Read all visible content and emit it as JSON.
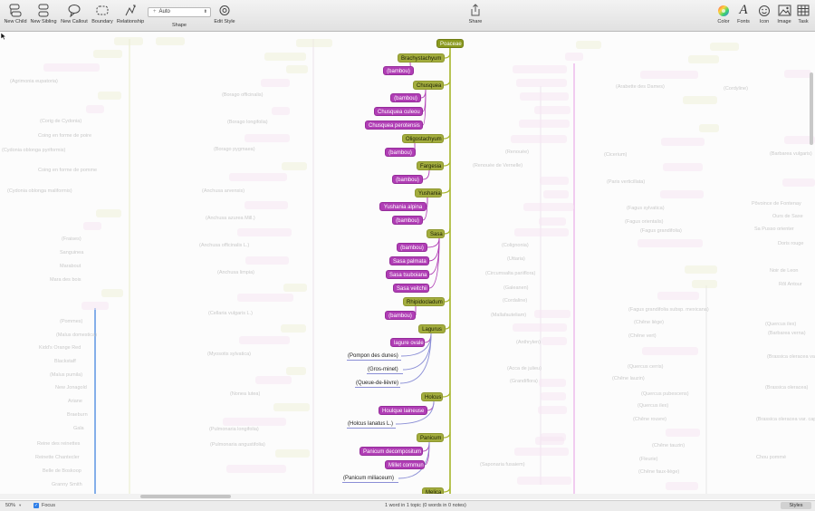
{
  "toolbar": {
    "new_child": "New Child",
    "new_sibling": "New Sibling",
    "new_callout": "New Callout",
    "boundary": "Boundary",
    "relationship": "Relationship",
    "shape_value": "Auto",
    "shape": "Shape",
    "edit_style": "Edit Style",
    "share": "Share",
    "color": "Color",
    "fonts": "Fonts",
    "icon": "Icon",
    "image": "Image",
    "task": "Task"
  },
  "map": {
    "root": "Poaceae",
    "nodes": [
      {
        "text": "Brachystachyum",
        "kind": "genus"
      },
      {
        "text": "(bambou)",
        "kind": "species"
      },
      {
        "text": "Chusquea",
        "kind": "genus"
      },
      {
        "text": "(bambou)",
        "kind": "species"
      },
      {
        "text": "Chusquea culeou",
        "kind": "species"
      },
      {
        "text": "Chusquea perotensis",
        "kind": "species"
      },
      {
        "text": "Oligostachyum",
        "kind": "genus"
      },
      {
        "text": "(bambou)",
        "kind": "species"
      },
      {
        "text": "Fargesia",
        "kind": "genus"
      },
      {
        "text": "(bambou)",
        "kind": "species"
      },
      {
        "text": "Yushania",
        "kind": "genus"
      },
      {
        "text": "Yushania alpina",
        "kind": "species"
      },
      {
        "text": "(bambou)",
        "kind": "species"
      },
      {
        "text": "Sasa",
        "kind": "genus"
      },
      {
        "text": "(bambou)",
        "kind": "species"
      },
      {
        "text": "Sasa palmata",
        "kind": "species"
      },
      {
        "text": "Sasa tsuboiana",
        "kind": "species"
      },
      {
        "text": "Sasa veitchii",
        "kind": "species"
      },
      {
        "text": "Rhipidocladum",
        "kind": "genus"
      },
      {
        "text": "(bambou)",
        "kind": "species"
      },
      {
        "text": "Lagurus",
        "kind": "genus"
      },
      {
        "text": "lagure ovale",
        "kind": "species"
      },
      {
        "text": "(Pompon des dunes)",
        "kind": "plain"
      },
      {
        "text": "(Gros-minet)",
        "kind": "plain"
      },
      {
        "text": "(Queue-de-lièvre)",
        "kind": "plain"
      },
      {
        "text": "Holcus",
        "kind": "genus"
      },
      {
        "text": "Houlque laineuse",
        "kind": "species"
      },
      {
        "text": "(Holcus lanatus L.)",
        "kind": "plain"
      },
      {
        "text": "Panicum",
        "kind": "genus"
      },
      {
        "text": "Panicum decompositum",
        "kind": "species"
      },
      {
        "text": "Millet commun",
        "kind": "species"
      },
      {
        "text": "(Panicum miliaceum)",
        "kind": "plain"
      },
      {
        "text": "Melica",
        "kind": "genus"
      }
    ],
    "faded": [
      "(Agrimonia eupatoria)",
      "(Corig de Cydonia)",
      "Coing en forme de poire",
      "(Cydonia oblonga pyriformis)",
      "Coing en forme de pomme",
      "(Cydonia oblonga maliformis)",
      "(Fraises)",
      "Sanguinea",
      "Marabout",
      "Mara des bois",
      "(Pommes)",
      "(Malus domestica)",
      "Kidd's Orange Red",
      "Blackstaff",
      "(Malus pumila)",
      "New Jonagold",
      "Ariane",
      "Braeburn",
      "Gala",
      "Reine des reinettes",
      "Reinette Chantecler",
      "Belle de Boskoop",
      "Granny Smith",
      "(Borago officinalis)",
      "(Borago longifolia)",
      "(Borago pygmaea)",
      "(Anchusa arvensis)",
      "(Anchusa azurea Mill.)",
      "(Anchusa officinalis L.)",
      "(Anchusa limpia)",
      "(Cellaria vulgaris L.)",
      "(Myosotis sylvatica)",
      "(Nonea lutea)",
      "(Pulmonaria longifolia)",
      "(Pulmonaria angustifolia)",
      "(Colignonia)",
      "(Uttaria)",
      "(Circumsalta pariiflora)",
      "(Galeanen)",
      "(Cordaline)",
      "(Mallafauteliam)",
      "(Anthrylen)",
      "(Acca de julieu)",
      "(Grandiflora)",
      "(Saponaria fusaiem)",
      "(Cicerium)",
      "(Paris verticillata)",
      "(Fagus sylvatica)",
      "(Fagus orientalis)",
      "(Fagus grandifolia)",
      "(Fagus grandifolia subsp. mexicana)",
      "(Chêne liège)",
      "(Chêne vert)",
      "(Quercus cerris)",
      "(Chêne lauzin)",
      "(Quercus pubescens)",
      "(Quercus ilex)",
      "(Chêne rouvre)",
      "(Chêne tauzin)",
      "(Fleurie)",
      "(Chêne faux-liège)",
      "(Quercus ilex)",
      "(Brassica oleracea var. botrytis)",
      "(Brassica oleracea)",
      "(Brassica oleracea var. capitata)",
      "Chou pommé",
      "(Barbarea vulgaris)",
      "Pôvoince de Fontenay",
      "Ours de Saxe",
      "Sa Pusso orienter",
      "Doris rouge",
      "Noir de Leon",
      "Rôl Antour",
      "(Barbarea verna)",
      "(Cordyline)",
      "(Arabette des Dames)",
      "(Renouée)",
      "(Renouée de Vernelle)"
    ]
  },
  "status": {
    "zoom": "50%",
    "focus": "Focus",
    "summary": "1 word in 1 topic (0 words in 0 notes)",
    "styles": "Styles"
  },
  "colors": {
    "genus": "#a3ad3e",
    "species": "#b03eb5",
    "plain_underline": "#8b8fd6",
    "trunk": "#a7b52b",
    "side_pink": "#e8a3e6",
    "side_blue": "#4a8be0"
  },
  "icons": {
    "new_child": "new-child-icon",
    "new_sibling": "new-sibling-icon",
    "new_callout": "callout-icon",
    "boundary": "boundary-icon",
    "relationship": "relationship-icon",
    "edit_style": "edit-style-icon",
    "share": "share-icon",
    "color": "color-wheel-icon",
    "fonts": "fonts-icon",
    "icon": "smiley-icon",
    "image": "image-icon",
    "task": "task-grid-icon"
  }
}
